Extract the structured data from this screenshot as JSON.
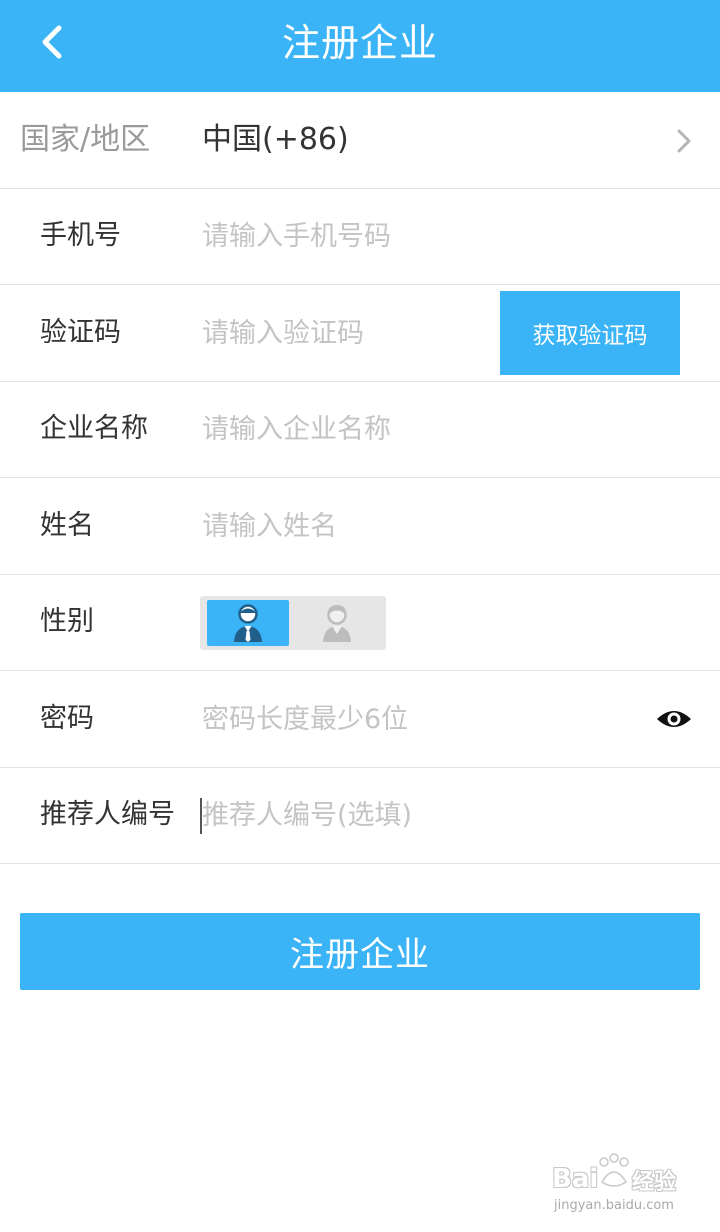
{
  "header": {
    "title": "注册企业",
    "back_icon": "chevron-left-icon"
  },
  "form": {
    "region": {
      "label": "国家/地区",
      "value": "中国(+86)",
      "icon": "chevron-right-icon"
    },
    "phone": {
      "label": "手机号",
      "placeholder": "请输入手机号码"
    },
    "code": {
      "label": "验证码",
      "placeholder": "请输入验证码",
      "button": "获取验证码"
    },
    "company": {
      "label": "企业名称",
      "placeholder": "请输入企业名称"
    },
    "name": {
      "label": "姓名",
      "placeholder": "请输入姓名"
    },
    "gender": {
      "label": "性别",
      "selected": "male",
      "options": [
        "male-icon",
        "female-icon"
      ]
    },
    "password": {
      "label": "密码",
      "placeholder": "密码长度最少6位",
      "icon": "eye-icon"
    },
    "referrer": {
      "label": "推荐人编号",
      "placeholder": "推荐人编号(选填)"
    }
  },
  "submit": {
    "label": "注册企业"
  },
  "watermark": {
    "brand": "Bai",
    "brand_cn": "经验",
    "domain": "jingyan.baidu.com"
  },
  "colors": {
    "accent": "#3bb4f7",
    "placeholder": "#c4c4c4",
    "divider": "#e4e4e4"
  }
}
